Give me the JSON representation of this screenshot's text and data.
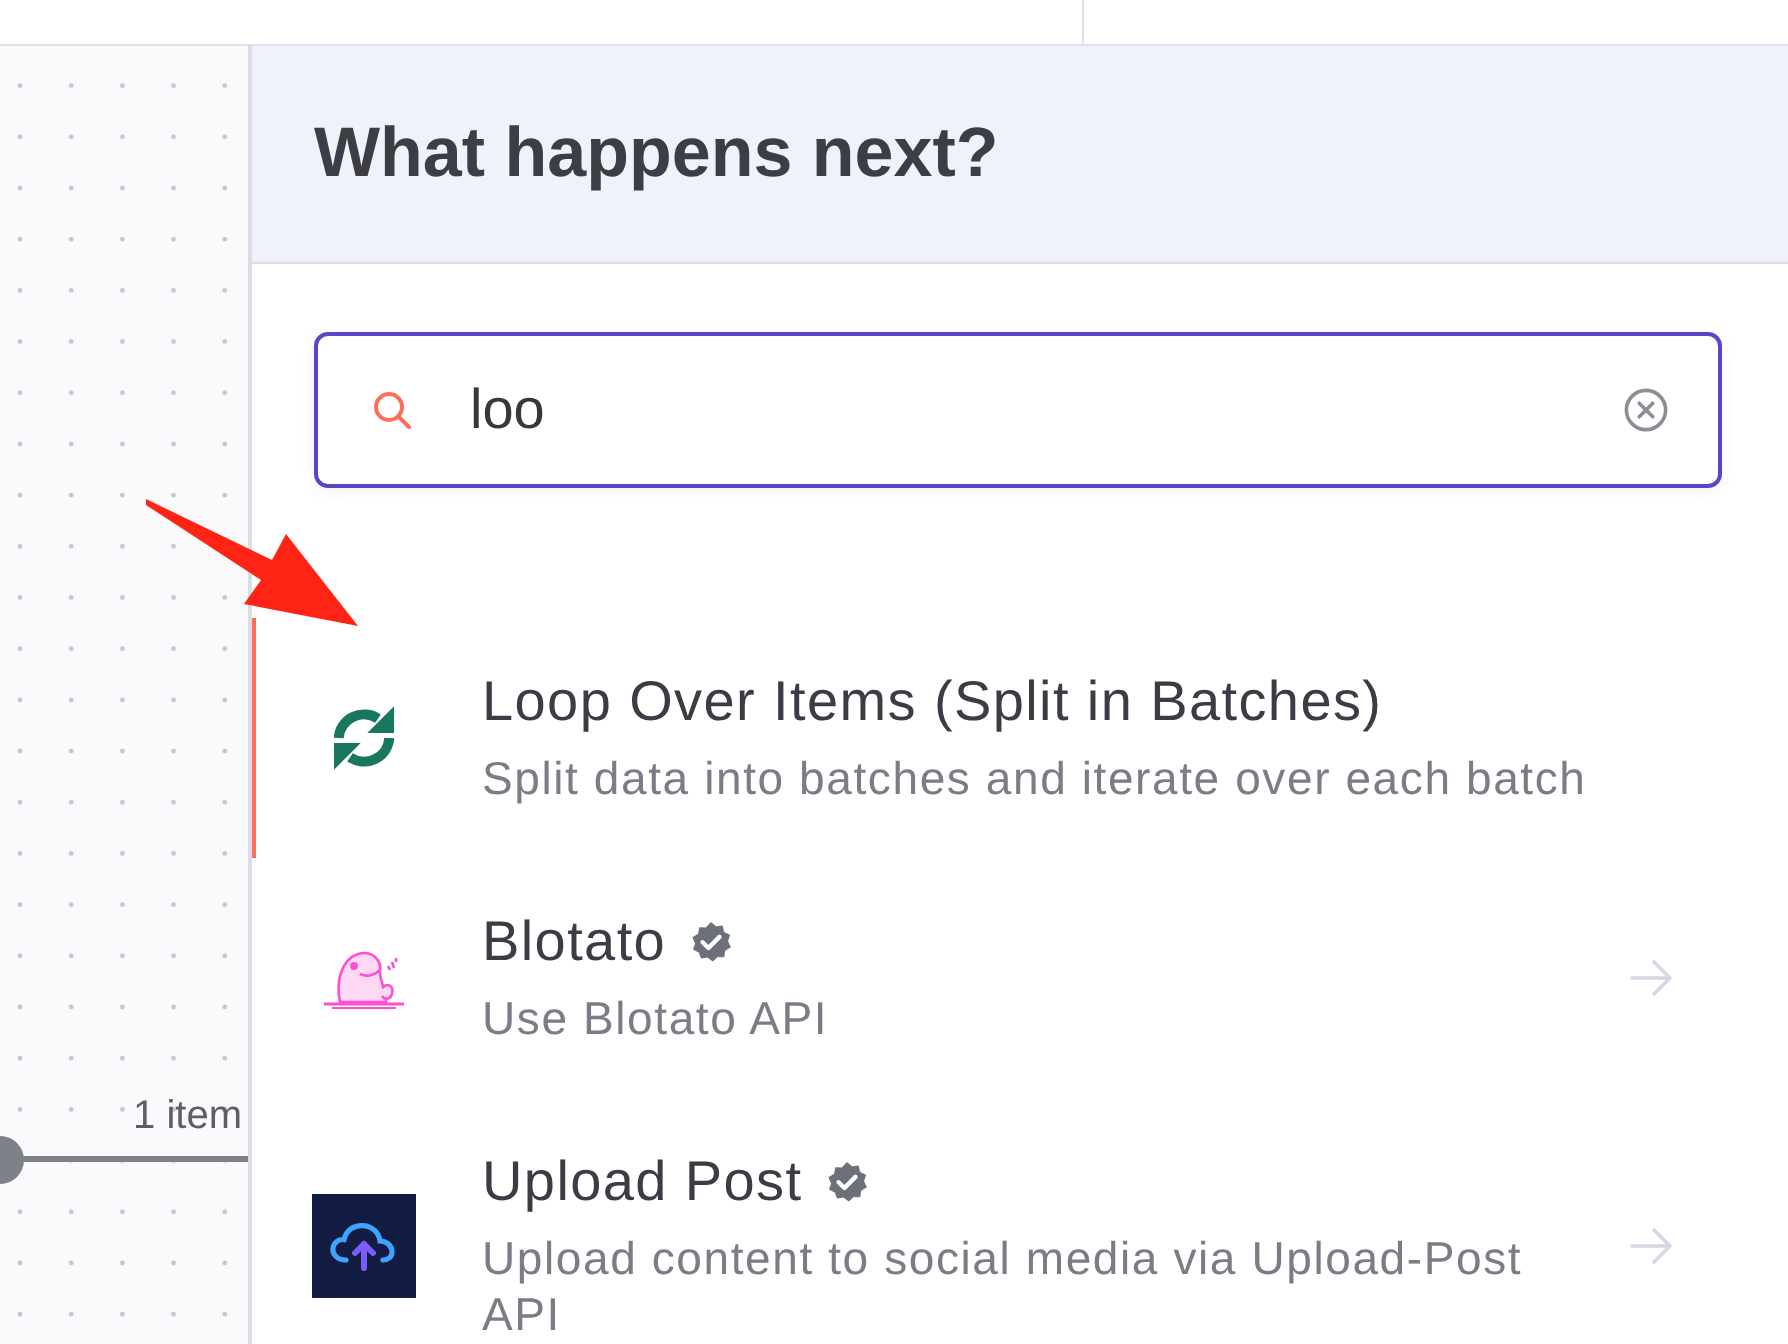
{
  "canvas": {
    "connection": {
      "label": "1 item"
    }
  },
  "panel": {
    "title": "What happens next?",
    "search": {
      "value": "loo"
    },
    "results": [
      {
        "kind": "loop",
        "title": "Loop Over Items (Split in Batches)",
        "description": "Split data into batches and iterate over each batch",
        "verified": false,
        "has_arrow": false,
        "selected": true
      },
      {
        "kind": "blotato",
        "title": "Blotato",
        "description": "Use Blotato API",
        "verified": true,
        "has_arrow": true,
        "selected": false
      },
      {
        "kind": "upload_post",
        "title": "Upload Post",
        "description": "Upload content to social media via Upload-Post API",
        "verified": true,
        "has_arrow": true,
        "selected": false
      }
    ]
  }
}
